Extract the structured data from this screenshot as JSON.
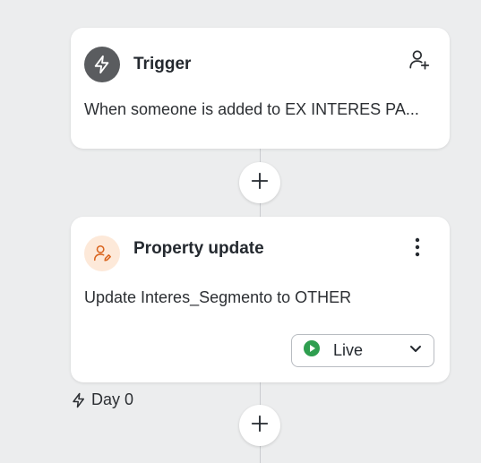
{
  "trigger": {
    "title": "Trigger",
    "description": "When someone is added to EX INTERES PA...",
    "icon": "lightning-icon",
    "action_icon": "add-person-icon"
  },
  "property_update": {
    "title": "Property update",
    "description": "Update Interes_Segmento to OTHER",
    "icon": "person-edit-icon",
    "menu_icon": "more-vertical-icon",
    "status": {
      "label": "Live",
      "icon": "play-circle-icon",
      "color": "#2e9e4f"
    }
  },
  "delay": {
    "label": "Day 0",
    "icon": "lightning-icon"
  },
  "add_step_icon": "plus-icon",
  "colors": {
    "background": "#ecedee",
    "trigger_icon_bg": "#5a5c5f",
    "property_icon_bg": "#fde9d9",
    "property_icon_fg": "#d9641e",
    "live_green": "#2e9e4f"
  }
}
